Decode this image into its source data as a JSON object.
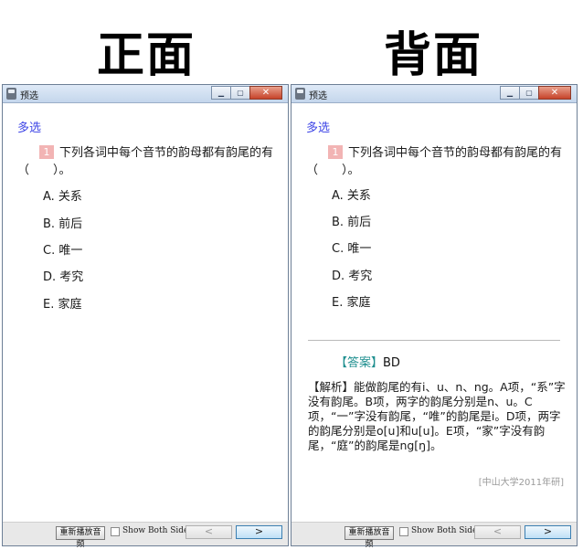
{
  "headings": {
    "front": "正面",
    "back": "背面"
  },
  "window": {
    "title": "预选",
    "controls": {
      "minimize": "▁",
      "maximize": "▢",
      "close": "✕"
    }
  },
  "question": {
    "type": "多选",
    "number": "1",
    "stem": "下列各词中每个音节的韵母都有韵尾的有（　　）。",
    "options": [
      "A. 关系",
      "B. 前后",
      "C. 唯一",
      "D. 考究",
      "E. 家庭"
    ]
  },
  "answer": {
    "tag": "【答案】",
    "value": "BD",
    "explanation": "【解析】能做韵尾的有i、u、n、ng。A项，“系”字没有韵尾。B项，两字的韵尾分别是n、u。C项，“一”字没有韵尾，“唯”的韵尾是i。D项，两字的韵尾分别是o[u]和u[u]。E项，“家”字没有韵尾，“庭”的韵尾是ng[ŋ]。",
    "source": "[中山大学2011年研]"
  },
  "footer": {
    "replay_label": "重新播放音频",
    "show_both_label": "Show Both Sides",
    "prev_label": "<",
    "next_label": ">"
  }
}
